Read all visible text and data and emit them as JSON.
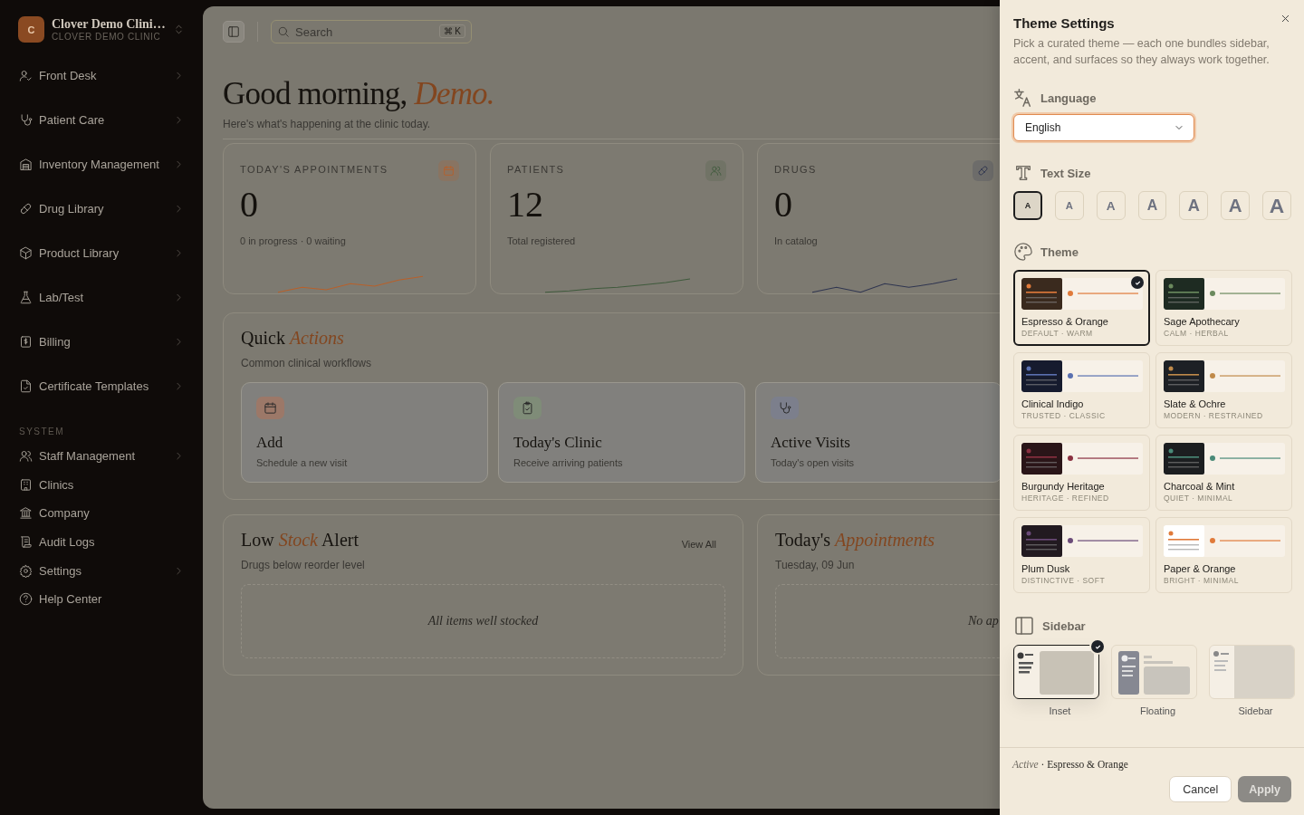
{
  "sidebar": {
    "workspace": {
      "initial": "C",
      "name": "Clover Demo Clini…",
      "subtitle": "CLOVER DEMO CLINIC"
    },
    "items": [
      {
        "label": "Front Desk",
        "expandable": true
      },
      {
        "label": "Patient Care",
        "expandable": true
      },
      {
        "label": "Inventory Management",
        "expandable": true
      },
      {
        "label": "Drug Library",
        "expandable": true
      },
      {
        "label": "Product Library",
        "expandable": true
      },
      {
        "label": "Lab/Test",
        "expandable": true
      },
      {
        "label": "Billing",
        "expandable": true
      },
      {
        "label": "Certificate Templates",
        "expandable": true
      }
    ],
    "section": {
      "title": "SYSTEM",
      "items": [
        {
          "label": "Staff Management",
          "expandable": true
        },
        {
          "label": "Clinics",
          "expandable": false
        },
        {
          "label": "Company",
          "expandable": false
        },
        {
          "label": "Audit Logs",
          "expandable": false
        },
        {
          "label": "Settings",
          "expandable": true
        },
        {
          "label": "Help Center",
          "expandable": false
        }
      ]
    }
  },
  "toolbar": {
    "search": {
      "placeholder": "Search",
      "shortcut": "⌘ K"
    }
  },
  "greeting": {
    "title": "Good morning, *Demo.*",
    "subtitle": "Here's what's happening at the clinic today."
  },
  "stats": [
    {
      "label": "TODAY'S APPOINTMENTS",
      "value": "0",
      "caption": "0 in progress · 0 waiting",
      "color": "#b8602a"
    },
    {
      "label": "PATIENTS",
      "value": "12",
      "caption": "Total registered",
      "color": "#3f5a3c"
    },
    {
      "label": "DRUGS",
      "value": "0",
      "caption": "In catalog",
      "color": "#2f3550"
    }
  ],
  "quick_actions": {
    "title": "Quick *Actions*",
    "subtitle": "Common clinical workflows",
    "actions": [
      {
        "title": "Add",
        "subtitle": "Schedule a new visit",
        "color": "#9c7868"
      },
      {
        "title": "Today's Clinic",
        "subtitle": "Receive arriving patients",
        "color": "#7f8c78"
      },
      {
        "title": "Active Visits",
        "subtitle": "Today's open visits",
        "color": "#7c7f8c"
      }
    ]
  },
  "low_stock": {
    "title": "Low *Stock* Alert",
    "subtitle": "Drugs below reorder level",
    "link": "View All",
    "empty": "All items well stocked"
  },
  "appointments": {
    "title": "Today's *Appointments*",
    "subtitle": "Tuesday, 09 Jun",
    "empty": "No ap"
  },
  "theme_settings": {
    "title": "Theme Settings",
    "description": "Pick a curated theme — each one bundles sidebar, accent, and surfaces so they always work together.",
    "language": {
      "label": "Language",
      "value": "English"
    },
    "text_size": {
      "label": "Text Size",
      "options": [
        {
          "label": "A",
          "selected": true
        },
        {
          "label": "A",
          "selected": false
        },
        {
          "label": "A",
          "selected": false
        },
        {
          "label": "A",
          "selected": false
        },
        {
          "label": "A",
          "selected": false
        },
        {
          "label": "A",
          "selected": false
        },
        {
          "label": "A",
          "selected": false
        }
      ]
    },
    "theme": {
      "label": "Theme",
      "options": [
        {
          "name": "Espresso & Orange",
          "tags": "DEFAULT · WARM",
          "color": "#e07a3a",
          "selected": true
        },
        {
          "name": "Sage Apothecary",
          "tags": "CALM · HERBAL",
          "color": "#6b8a5e",
          "selected": false
        },
        {
          "name": "Clinical Indigo",
          "tags": "TRUSTED · CLASSIC",
          "color": "#5a70b0",
          "selected": false
        },
        {
          "name": "Slate & Ochre",
          "tags": "MODERN · RESTRAINED",
          "color": "#c08a4a",
          "selected": false
        },
        {
          "name": "Burgundy Heritage",
          "tags": "HERITAGE · REFINED",
          "color": "#8a3040",
          "selected": false
        },
        {
          "name": "Charcoal & Mint",
          "tags": "QUIET · MINIMAL",
          "color": "#4a8a78",
          "selected": false
        },
        {
          "name": "Plum Dusk",
          "tags": "DISTINCTIVE · SOFT",
          "color": "#6a4a78",
          "selected": false
        },
        {
          "name": "Paper & Orange",
          "tags": "BRIGHT · MINIMAL",
          "color": "#e07a3a",
          "selected": false
        }
      ]
    },
    "sidebar": {
      "label": "Sidebar",
      "options": [
        {
          "label": "Inset",
          "kind": "inset",
          "selected": true
        },
        {
          "label": "Floating",
          "kind": "floating",
          "selected": false
        },
        {
          "label": "Sidebar",
          "kind": "sidebar",
          "selected": false
        }
      ]
    },
    "footer": {
      "active": "*Active* · Espresso & Orange",
      "cancel": "Cancel",
      "apply": "Apply",
      "apply_disabled": true
    }
  }
}
